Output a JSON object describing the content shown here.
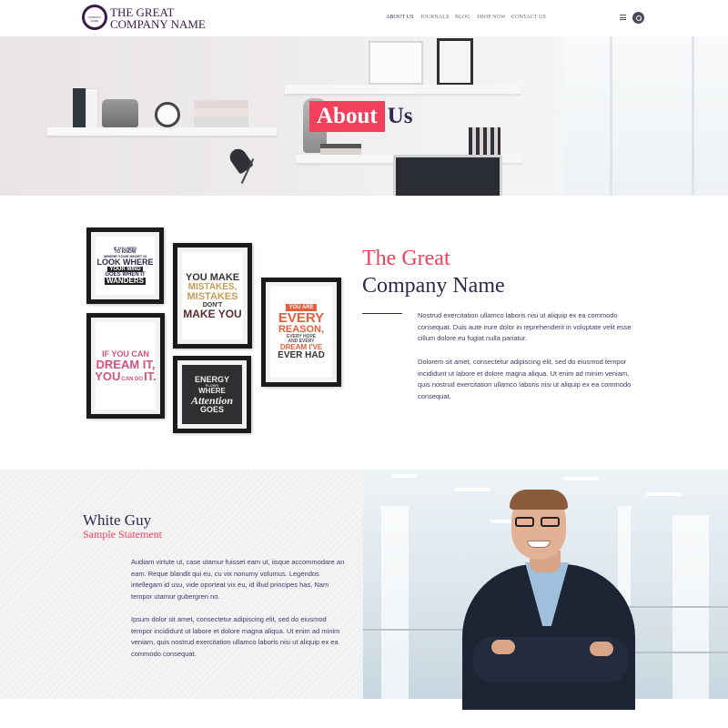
{
  "header": {
    "logo_line1": "THE GREAT",
    "logo_line2": "COMPANY NAME",
    "logo_ring_text": "COMPANY NAME",
    "nav": [
      "ABOUT US",
      "JOURNALS",
      "BLOG",
      "SHOP NOW",
      "CONTACT US"
    ],
    "active_nav": "ABOUT US",
    "icons": [
      "menu-icon",
      "search-icon"
    ]
  },
  "hero": {
    "title_highlight": "About",
    "title_rest": "Us"
  },
  "about": {
    "title_line1": "The Great",
    "title_line2": "Company Name",
    "paragraph1": "Nostrud exercitation ullamco laboris nisi ut aliquip ex ea commodo consequat. Duis aute irure dolor in reprehenderit in voluptate velit esse cillum dolore eu fugiat nulla pariatur.",
    "paragraph2": "Dolorem sit amet, consectetur adipiscing elit, sed do eiusmod tempor incididunt ut labore et dolore magna aliqua. Ut enim ad minim veniam, quis nostrud exercitation ullamco laboris nisi ut aliquip ex ea commodo consequat.",
    "posters": {
      "p1": [
        "IF YOU NEED",
        "TO KNOW",
        "WHERE YOUR HEART IS",
        "LOOK WHERE",
        "YOUR MIND",
        "GOES WHEN IT",
        "WANDERS"
      ],
      "p2": [
        "YOU MAKE",
        "MISTAKES,",
        "MISTAKES",
        "DON'T",
        "MAKE YOU"
      ],
      "p3": [
        "YOU ARE",
        "EVERY",
        "REASON,",
        "EVERY HOPE",
        "AND EVERY",
        "DREAM I'VE",
        "EVER HAD"
      ],
      "p4": [
        "IF YOU CAN",
        "DREAM IT,",
        "YOU",
        "CAN DO",
        "IT."
      ],
      "p5": [
        "ENERGY",
        "FLOWS",
        "WHERE",
        "Attention",
        "GOES"
      ]
    }
  },
  "team": {
    "name": "White Guy",
    "subtitle": "Sample Statement",
    "paragraph1": "Audiam virtute ut, case utamur fuisset eam ut, iisque accommodare an eam. Reque blandit qui eu, cu vix nonumy volumus. Legendos intellegam id usu, vide oporteat vix eu, id illud principes has. Nam tempor utamur gubergren no.",
    "paragraph2": "Ipsum dolor sit amet, consectetur adipiscing elit, sed do eiusmod tempor incididunt ut labore et dolore magna aliqua. Ut enim ad minim veniam, quis nostrud exercitation ullamco laboris nisi ut aliquip ex ea commodo consequat."
  },
  "colors": {
    "accent": "#f2405c",
    "navy": "#2b2a4c",
    "logo": "#3a1a4a"
  }
}
